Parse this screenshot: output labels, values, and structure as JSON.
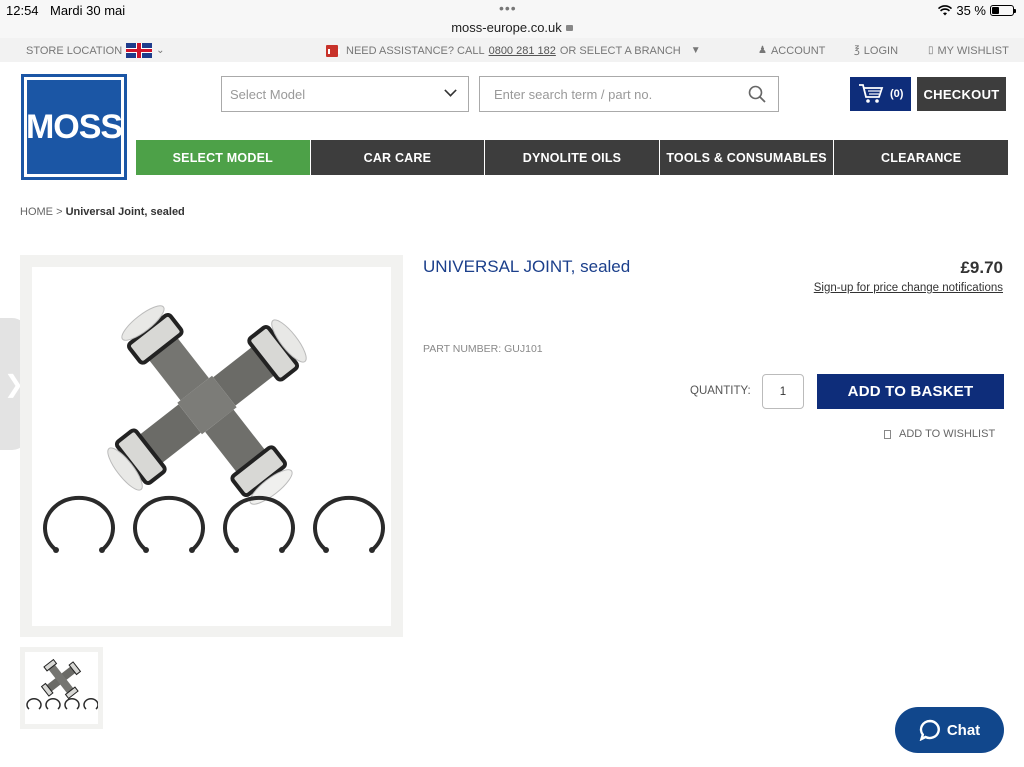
{
  "status_bar": {
    "time": "12:54",
    "date": "Mardi 30 mai",
    "url": "moss-europe.co.uk",
    "battery": "35 %",
    "battery_level": 0.35
  },
  "util_bar": {
    "store_location": "STORE LOCATION",
    "assistance_prefix": "NEED ASSISTANCE? CALL",
    "phone": "0800 281 182",
    "assistance_suffix": "OR SELECT A BRANCH",
    "account": "ACCOUNT",
    "login": "LOGIN",
    "wishlist": "MY WISHLIST"
  },
  "header": {
    "logo_text": "MOSS",
    "select_model_placeholder": "Select Model",
    "search_placeholder": "Enter search term / part no.",
    "cart_count": "(0)",
    "checkout": "CHECKOUT",
    "brand_color": "#1b56a5",
    "primary_color": "#0e2d7a"
  },
  "nav": {
    "items": [
      {
        "label": "SELECT MODEL",
        "active": true
      },
      {
        "label": "CAR CARE",
        "active": false
      },
      {
        "label": "DYNOLITE OILS",
        "active": false
      },
      {
        "label": "TOOLS & CONSUMABLES",
        "active": false
      },
      {
        "label": "CLEARANCE",
        "active": false
      }
    ],
    "active_color": "#4da148"
  },
  "breadcrumb": {
    "home": "HOME",
    "separator": ">",
    "current": "Universal Joint, sealed"
  },
  "product": {
    "title": "UNIVERSAL JOINT, sealed",
    "price": "£9.70",
    "price_notify": "Sign-up for price change notifications",
    "part_number": "PART NUMBER: GUJ101",
    "quantity_label": "QUANTITY:",
    "quantity": "1",
    "add_to_basket": "ADD TO BASKET",
    "add_to_wishlist": "ADD TO WISHLIST"
  },
  "chat": {
    "label": "Chat"
  }
}
